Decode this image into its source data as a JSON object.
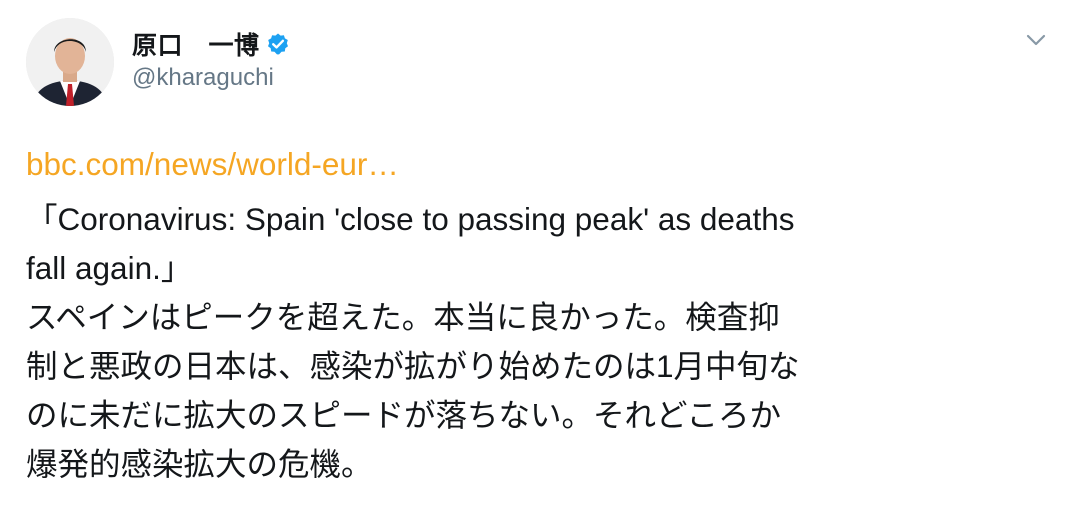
{
  "author": {
    "display_name": "原口　一博",
    "handle": "@kharaguchi",
    "verified": true
  },
  "tweet": {
    "link_text": "bbc.com/news/world-eur…",
    "lines": [
      "「Coronavirus: Spain 'close to passing peak' as deaths",
      "fall again.」",
      "スペインはピークを超えた。本当に良かった。検査抑",
      "制と悪政の日本は、感染が拡がり始めたのは1月中旬な",
      "のに未だに拡大のスピードが落ちない。それどころか",
      "爆発的感染拡大の危機。"
    ]
  },
  "icons": {
    "verified": "verified-badge-icon",
    "menu": "chevron-down-icon"
  },
  "colors": {
    "link": "#f5a623",
    "verified": "#1da1f2",
    "secondary_text": "#657786",
    "primary_text": "#14171a"
  }
}
